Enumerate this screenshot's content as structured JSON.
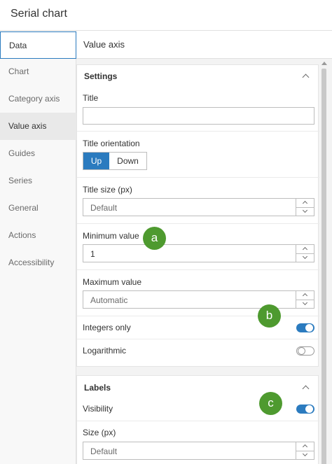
{
  "window": {
    "title": "Serial chart"
  },
  "nav": {
    "items": [
      {
        "label": "Data"
      },
      {
        "label": "Chart"
      },
      {
        "label": "Category axis"
      },
      {
        "label": "Value axis"
      },
      {
        "label": "Guides"
      },
      {
        "label": "Series"
      },
      {
        "label": "General"
      },
      {
        "label": "Actions"
      },
      {
        "label": "Accessibility"
      }
    ]
  },
  "panel": {
    "title": "Value axis"
  },
  "settings": {
    "title": "Settings",
    "title_label": "Title",
    "title_value": "",
    "orientation_label": "Title orientation",
    "orientation_options": [
      "Up",
      "Down"
    ],
    "orientation_selected": "Up",
    "title_size_label": "Title size (px)",
    "title_size_placeholder": "Default",
    "min_label": "Minimum value",
    "min_value": "1",
    "max_label": "Maximum value",
    "max_placeholder": "Automatic",
    "integers_label": "Integers only",
    "integers_on": true,
    "log_label": "Logarithmic",
    "log_on": false
  },
  "labels": {
    "title": "Labels",
    "visibility_label": "Visibility",
    "visibility_on": true,
    "size_label": "Size (px)",
    "size_placeholder": "Default"
  },
  "callouts": [
    "a",
    "b",
    "c"
  ],
  "colors": {
    "accent": "#2b7bbf",
    "callout": "#4e9a2f"
  }
}
